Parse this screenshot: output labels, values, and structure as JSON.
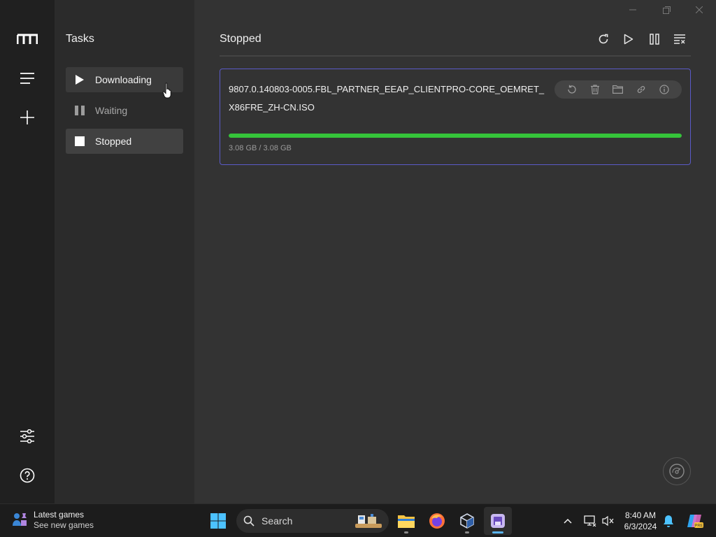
{
  "sidebar": {
    "title": "Tasks",
    "items": [
      {
        "label": "Downloading",
        "icon": "play-icon"
      },
      {
        "label": "Waiting",
        "icon": "pause-icon"
      },
      {
        "label": "Stopped",
        "icon": "stop-icon"
      }
    ]
  },
  "main": {
    "title": "Stopped",
    "task": {
      "name": "9807.0.140803-0005.FBL_PARTNER_EEAP_CLIENTPRO-CORE_OEMRET_X86FRE_ZH-CN.ISO",
      "size": "3.08 GB / 3.08 GB",
      "progress": 1.0
    }
  },
  "taskbar": {
    "widget": {
      "title": "Latest games",
      "subtitle": "See new games"
    },
    "search_label": "Search",
    "time": "8:40 AM",
    "date": "6/3/2024"
  },
  "colors": {
    "accent_border": "#5a5ac8",
    "progress": "#35c43a",
    "taskbar_accent": "#5ab4f0"
  }
}
